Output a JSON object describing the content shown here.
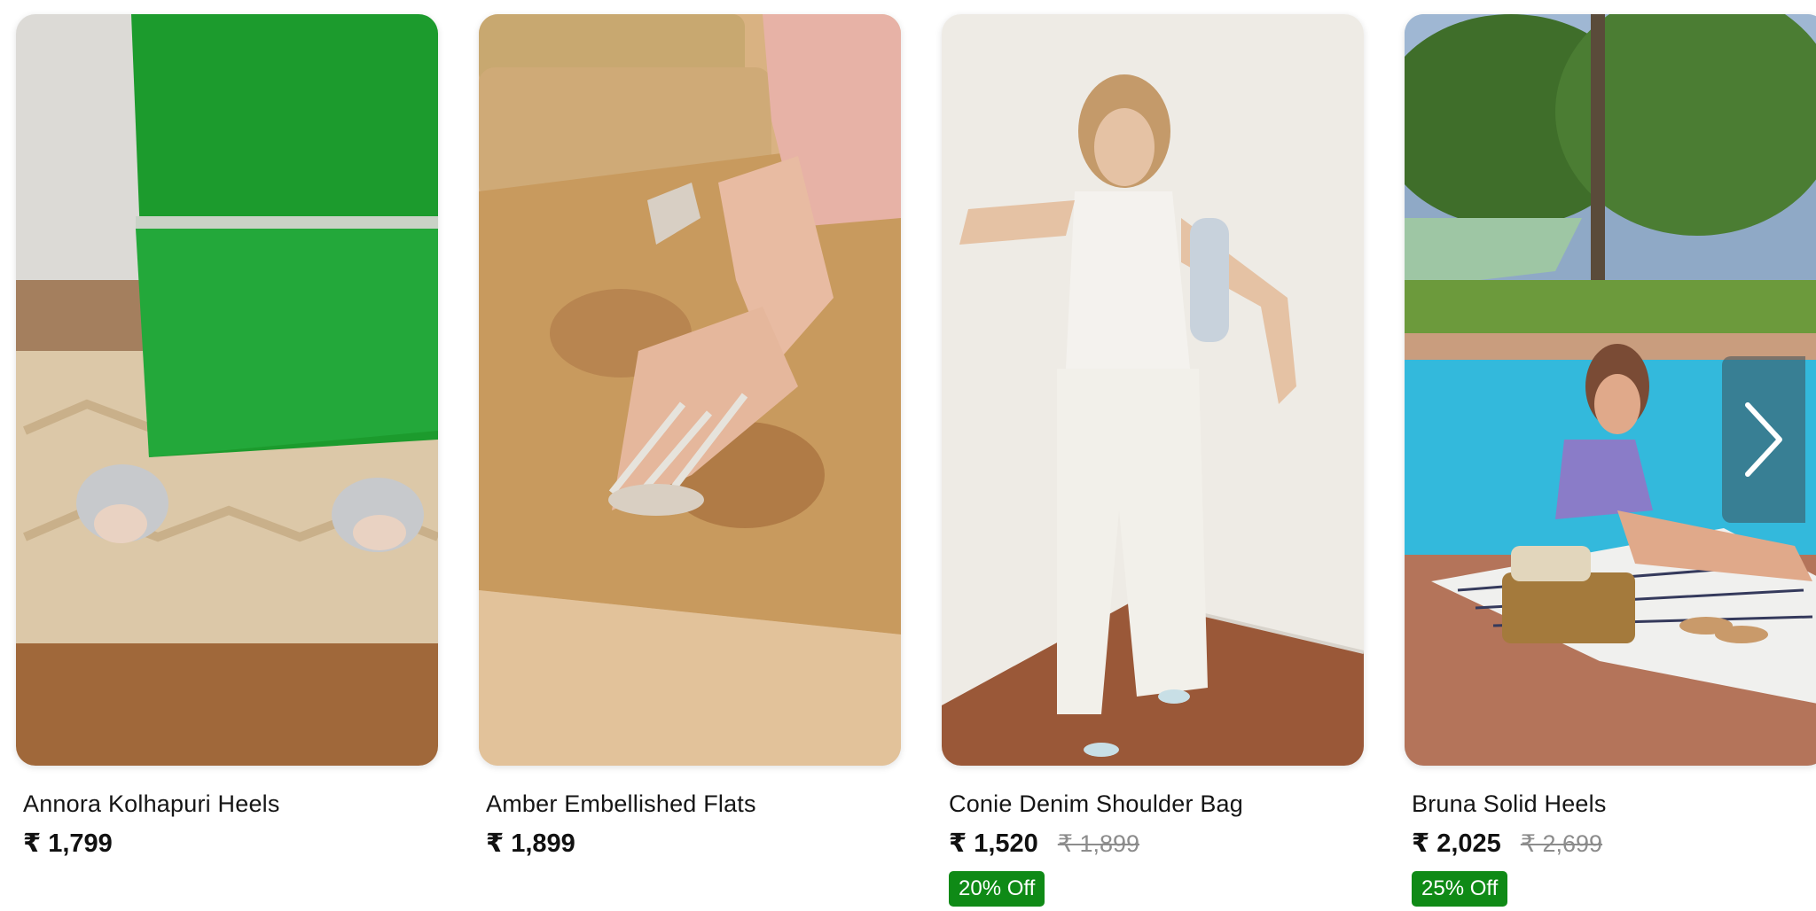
{
  "products": [
    {
      "title": "Annora Kolhapuri Heels",
      "price": "₹ 1,799",
      "mrp": "",
      "discount": "",
      "image": "green-lace-pants-silver-kolhapuri-heels"
    },
    {
      "title": "Amber Embellished Flats",
      "price": "₹ 1,899",
      "mrp": "",
      "discount": "",
      "image": "embellished-strappy-flats-on-jute-rug"
    },
    {
      "title": "Conie Denim Shoulder Bag",
      "price": "₹ 1,520",
      "mrp": "₹ 1,899",
      "discount": "20% Off",
      "image": "woman-in-white-outfit-with-shoulder-bag"
    },
    {
      "title": "Bruna Solid Heels",
      "price": "₹ 2,025",
      "mrp": "₹ 2,699",
      "discount": "25% Off",
      "image": "woman-by-pool-with-picnic-basket"
    }
  ],
  "carousel": {
    "next_icon": "chevron-right-icon"
  },
  "colors": {
    "discount_badge": "#0f8a16",
    "mrp_text": "#8c8c8c",
    "accent_green": "#1f9a2e"
  }
}
